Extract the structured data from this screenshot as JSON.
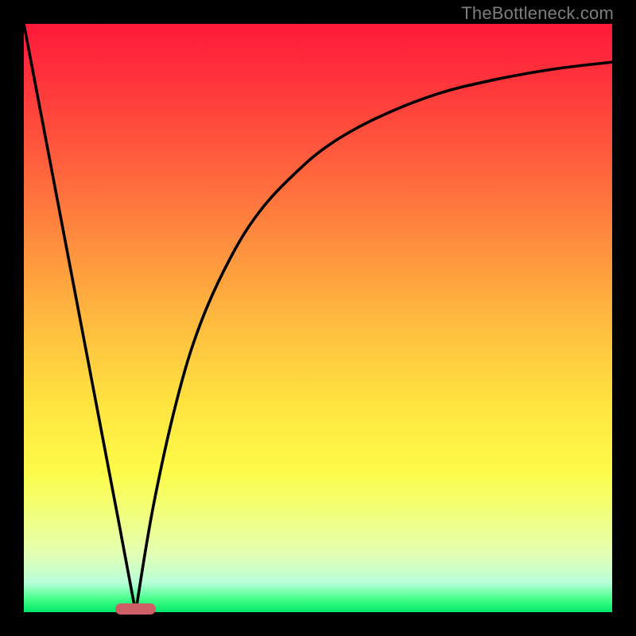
{
  "watermark": "TheBottleneck.com",
  "colors": {
    "frame": "#000000",
    "watermark": "#7d7d7d",
    "curve": "#000000",
    "marker": "#ce5f66"
  },
  "chart_data": {
    "type": "line",
    "title": "",
    "xlabel": "",
    "ylabel": "",
    "xlim": [
      0,
      100
    ],
    "ylim": [
      0,
      100
    ],
    "grid": false,
    "legend": false,
    "series": [
      {
        "name": "left-branch",
        "x": [
          0,
          4,
          8,
          12,
          16,
          19
        ],
        "values": [
          100,
          79,
          58,
          37,
          16,
          0
        ]
      },
      {
        "name": "right-branch",
        "x": [
          19,
          22,
          26,
          30,
          35,
          40,
          46,
          52,
          60,
          70,
          80,
          90,
          100
        ],
        "values": [
          0,
          18,
          36,
          49,
          60,
          68,
          74.5,
          79.5,
          84,
          88,
          90.5,
          92.3,
          93.5
        ]
      }
    ],
    "marker": {
      "x_center": 19,
      "x_half_width": 3.5,
      "y": 0.5
    }
  }
}
